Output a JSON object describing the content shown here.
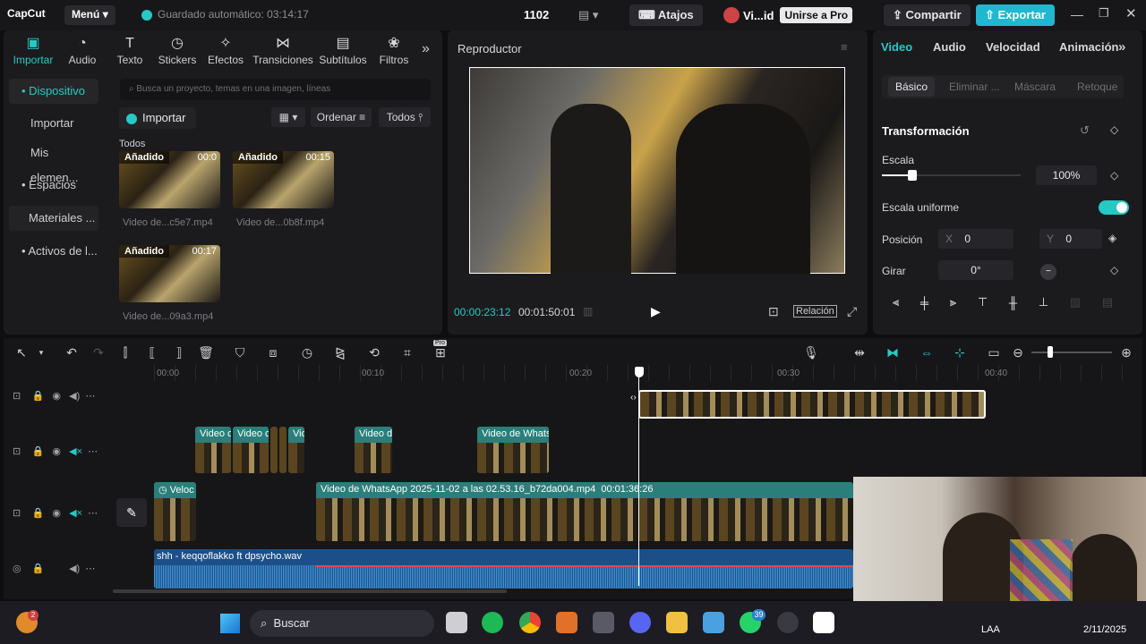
{
  "topbar": {
    "logo": "CapCut",
    "menu_label": "Menú",
    "autosave": "Guardado automático: 03:14:17",
    "project_name": "1102",
    "shortcuts_label": "Atajos",
    "user_label": "Vi...id",
    "pro_label": "Unirse a Pro",
    "share_label": "Compartir",
    "export_label": "Exportar"
  },
  "toolbar": {
    "items": [
      {
        "label": "Importar",
        "icon": "import-icon"
      },
      {
        "label": "Audio",
        "icon": "audio-icon"
      },
      {
        "label": "Texto",
        "icon": "text-icon"
      },
      {
        "label": "Stickers",
        "icon": "sticker-icon"
      },
      {
        "label": "Efectos",
        "icon": "effects-icon"
      },
      {
        "label": "Transiciones",
        "icon": "transitions-icon"
      },
      {
        "label": "Subtítulos",
        "icon": "subtitles-icon"
      },
      {
        "label": "Filtros",
        "icon": "filters-icon"
      }
    ]
  },
  "sidebar": {
    "items": [
      {
        "label": "• Dispositivo"
      },
      {
        "label": "Importar"
      },
      {
        "label": "Mis elemen..."
      },
      {
        "label": "• Espacios"
      },
      {
        "label": "Materiales ..."
      },
      {
        "label": "• Activos de l..."
      }
    ]
  },
  "media": {
    "search_placeholder": "Busca un proyecto, temas en una imagen, líneas",
    "import_label": "Importar",
    "sort_label": "Ordenar",
    "filter_label": "Todos",
    "section_label": "Todos",
    "items": [
      {
        "tag": "Añadido",
        "duration": "00:0",
        "name": "Video de...c5e7.mp4"
      },
      {
        "tag": "Añadido",
        "duration": "00:15",
        "name": "Video de...0b8f.mp4"
      },
      {
        "tag": "Añadido",
        "duration": "00:17",
        "name": "Video de...09a3.mp4"
      }
    ]
  },
  "player": {
    "title": "Reproductor",
    "current_time": "00:00:23:12",
    "total_time": "00:01:50:01",
    "ratio_label": "Relación"
  },
  "properties": {
    "tabs": [
      "Video",
      "Audio",
      "Velocidad",
      "Animación"
    ],
    "subtabs": [
      "Básico",
      "Eliminar ...",
      "Máscara",
      "Retoque"
    ],
    "section": "Transformación",
    "scale_label": "Escala",
    "scale_value": "100%",
    "uniform_label": "Escala uniforme",
    "uniform_on": true,
    "position_label": "Posición",
    "pos_x_label": "X",
    "pos_x": "0",
    "pos_y_label": "Y",
    "pos_y": "0",
    "rotate_label": "Girar",
    "rotate_value": "0°"
  },
  "timeline": {
    "ruler": [
      "00:00",
      "00:10",
      "00:20",
      "00:30",
      "00:40"
    ],
    "clips_row2": [
      "Video c",
      "Video c",
      "Vic",
      "Video d",
      "Video de Whats"
    ],
    "speed_clip_label": "Veloc",
    "main_clip_label": "Video de WhatsApp 2025-11-02 a las 02.53.16_b72da004.mp4",
    "main_clip_duration": "00:01:36:26",
    "audio_label": "shh - keqqoflakko ft dpsycho.wav",
    "pro_badge": "Pro"
  },
  "taskbar": {
    "search_label": "Buscar",
    "whatsapp_badge": "39",
    "keyboard_label": "LAA",
    "date": "2/11/2025"
  },
  "colors": {
    "accent": "#26c9c3",
    "export": "#1fb8d0",
    "clip": "#2a7f7a",
    "audio": "#1c4f8a"
  }
}
